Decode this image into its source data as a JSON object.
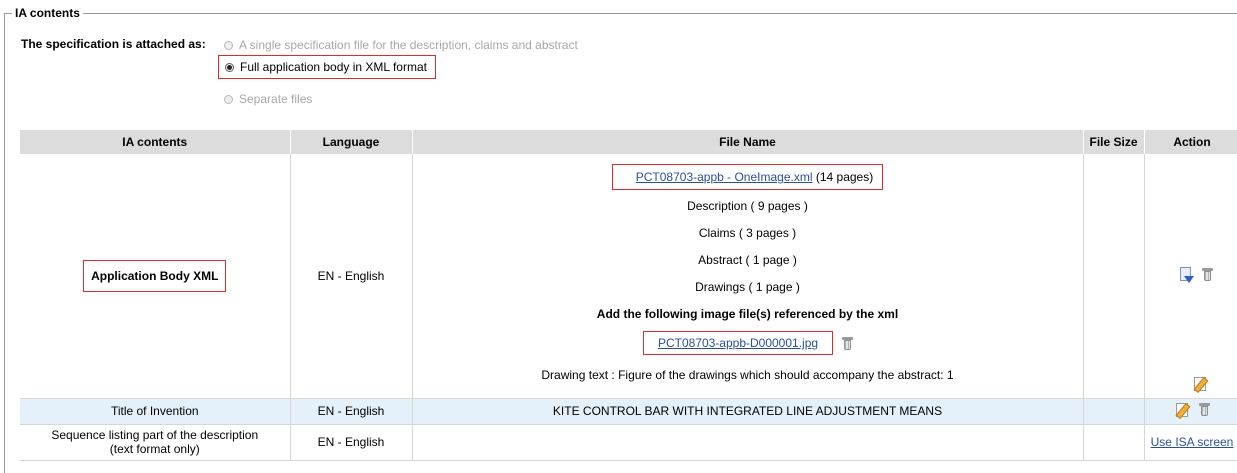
{
  "section": {
    "legend": "IA contents",
    "spec_label": "The specification is attached as:",
    "options": [
      {
        "label": "A single specification file for the description, claims and abstract",
        "selected": false,
        "enabled": false
      },
      {
        "label": "Full application body in XML format",
        "selected": true,
        "enabled": true
      },
      {
        "label": "Separate files",
        "selected": false,
        "enabled": false
      }
    ]
  },
  "table": {
    "headers": [
      "IA contents",
      "Language",
      "File Name",
      "File Size",
      "Action"
    ],
    "row_app": {
      "content": "Application Body XML",
      "language": "EN - English",
      "xml_file": "PCT08703-appb - OneImage.xml",
      "xml_pages": "(14 pages)",
      "parts": [
        "Description ( 9 pages )",
        "Claims ( 3 pages )",
        "Abstract ( 1 page )",
        "Drawings ( 1 page )"
      ],
      "image_heading": "Add the following image file(s) referenced by the xml",
      "image_file": "PCT08703-appb-D000001.jpg",
      "drawing_text": "Drawing text : Figure of the drawings which should accompany the abstract: 1",
      "file_size": ""
    },
    "row_title": {
      "content": "Title of Invention",
      "language": "EN - English",
      "file": "KITE CONTROL BAR WITH INTEGRATED LINE ADJUSTMENT MEANS"
    },
    "row_seq": {
      "content_line1": "Sequence listing part of the description",
      "content_line2": "(text format only)",
      "language": "EN - English",
      "action_link": "Use ISA screen"
    }
  },
  "icons": {
    "download": "download-icon",
    "delete": "trash-icon",
    "edit": "edit-icon"
  },
  "colors": {
    "highlight_box": "#e0292b",
    "header_bg": "#dcdcdc",
    "alt_row_bg": "#e4f0fa",
    "link": "#2a4f9e"
  }
}
